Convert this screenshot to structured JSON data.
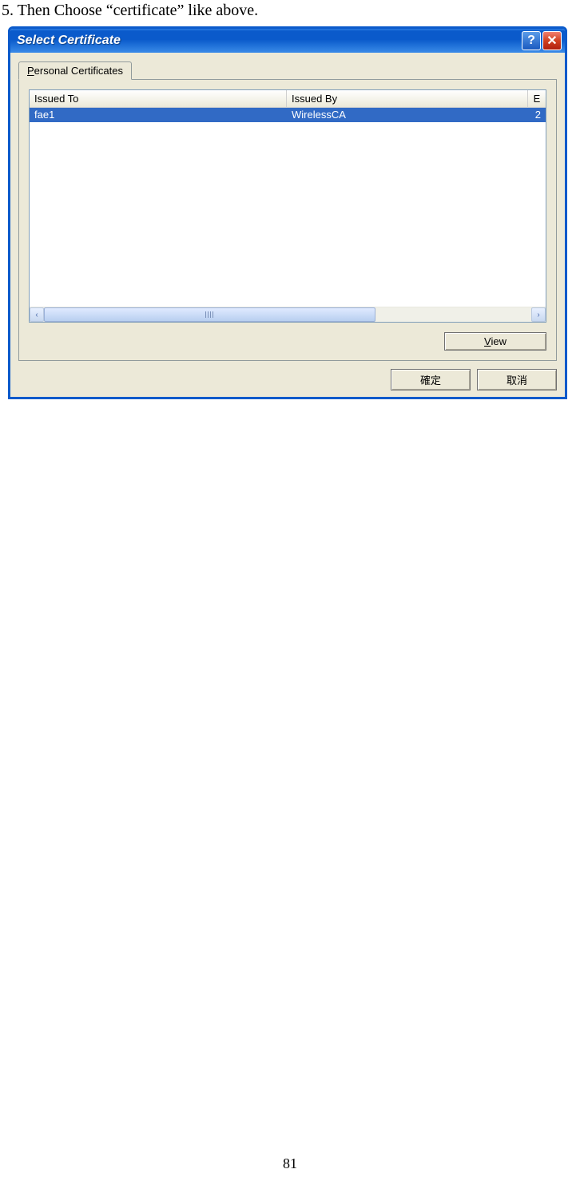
{
  "instruction": "5. Then Choose “certificate” like above.",
  "dialog": {
    "title": "Select Certificate",
    "help_glyph": "?",
    "close_glyph": "✕",
    "tab_label_pre": "P",
    "tab_label_post": "ersonal Certificates",
    "columns": {
      "issued_to": "Issued To",
      "issued_by": "Issued By",
      "extra": "E"
    },
    "rows": [
      {
        "issued_to": "fae1",
        "issued_by": "WirelessCA",
        "extra": "2"
      }
    ],
    "scroll": {
      "left_glyph": "‹",
      "right_glyph": "›"
    },
    "buttons": {
      "view_pre": "V",
      "view_post": "iew",
      "ok": "確定",
      "cancel": "取消"
    }
  },
  "page_number": "81"
}
